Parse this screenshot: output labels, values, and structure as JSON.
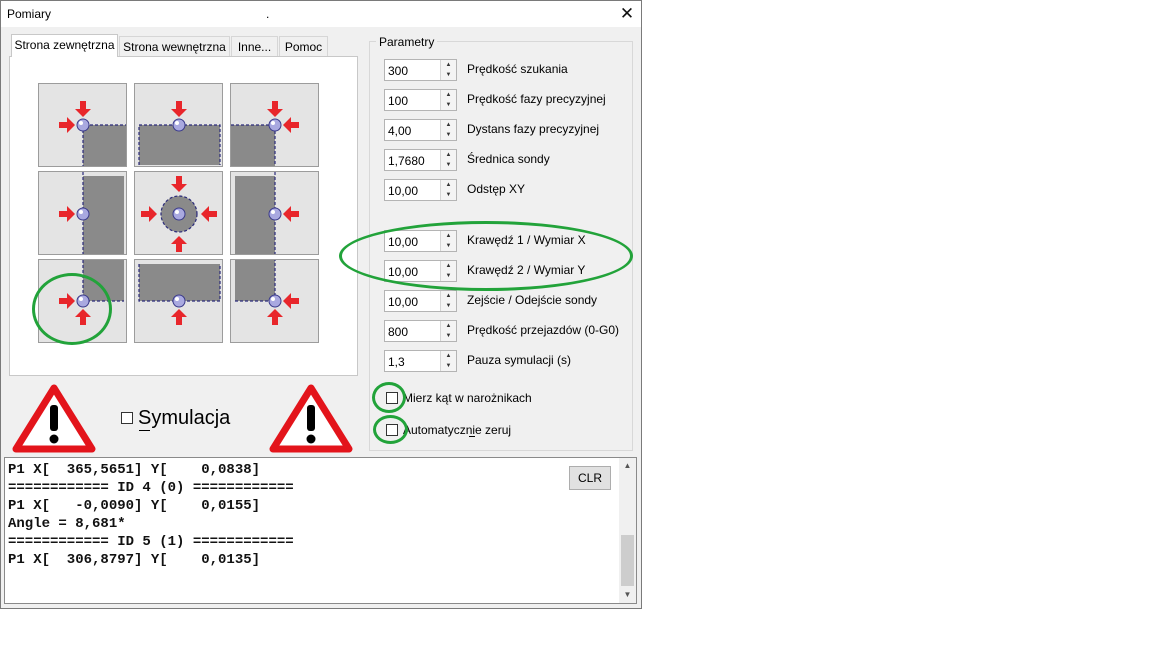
{
  "window": {
    "title": "Pomiary",
    "title_dot": ".",
    "close_glyph": "✕"
  },
  "tabs": [
    {
      "label": "Strona zewnętrzna",
      "active": true
    },
    {
      "label": "Strona wewnętrzna",
      "active": false
    },
    {
      "label": "Inne...",
      "active": false
    },
    {
      "label": "Pomoc",
      "active": false
    }
  ],
  "probe_grid": {
    "cells": [
      "corner-top-left",
      "edge-top",
      "corner-top-right",
      "edge-left",
      "center-circle",
      "edge-right",
      "corner-bottom-left",
      "edge-bottom",
      "corner-bottom-right"
    ]
  },
  "simulation": {
    "label": "Symulacja",
    "checked": false,
    "warning_icon": "warning-triangle-icon"
  },
  "parameters": {
    "group_label": "Parametry",
    "rows": [
      {
        "value": "300",
        "label": "Prędkość szukania"
      },
      {
        "value": "100",
        "label": "Prędkość fazy precyzyjnej"
      },
      {
        "value": "4,00",
        "label": "Dystans fazy precyzyjnej"
      },
      {
        "value": "1,7680",
        "label": "Średnica sondy"
      },
      {
        "value": "10,00",
        "label": "Odstęp XY"
      },
      {
        "value": "10,00",
        "label": "Krawędź 1 / Wymiar X"
      },
      {
        "value": "10,00",
        "label": "Krawędź 2 / Wymiar Y"
      },
      {
        "value": "10,00",
        "label": "Zejście / Odejście sondy"
      },
      {
        "value": "800",
        "label": "Prędkość przejazdów (0-G0)"
      },
      {
        "value": "1,3",
        "label": "Pauza symulacji (s)"
      }
    ],
    "spin_up": "▲",
    "spin_down": "▼",
    "check_corners": {
      "label": "Mierz kąt w narożnikach",
      "checked": false
    },
    "check_autozero": {
      "label": "Automatycznie zeruj",
      "checked": false
    }
  },
  "console": {
    "lines": [
      "P1 X[  365,5651] Y[    0,0838]",
      "============ ID 4 (0) ============",
      "P1 X[   -0,0090] Y[    0,0155]",
      "Angle = 8,681*",
      "============ ID 5 (1) ============",
      "P1 X[  306,8797] Y[    0,0135]"
    ],
    "clear_button": "CLR",
    "scroll_up": "▲",
    "scroll_down": "▼"
  },
  "colors": {
    "highlight_ring": "#22a33a",
    "arrow": "#e8262b",
    "warning": "#e3141b",
    "probe_block": "#8a8a8a"
  }
}
